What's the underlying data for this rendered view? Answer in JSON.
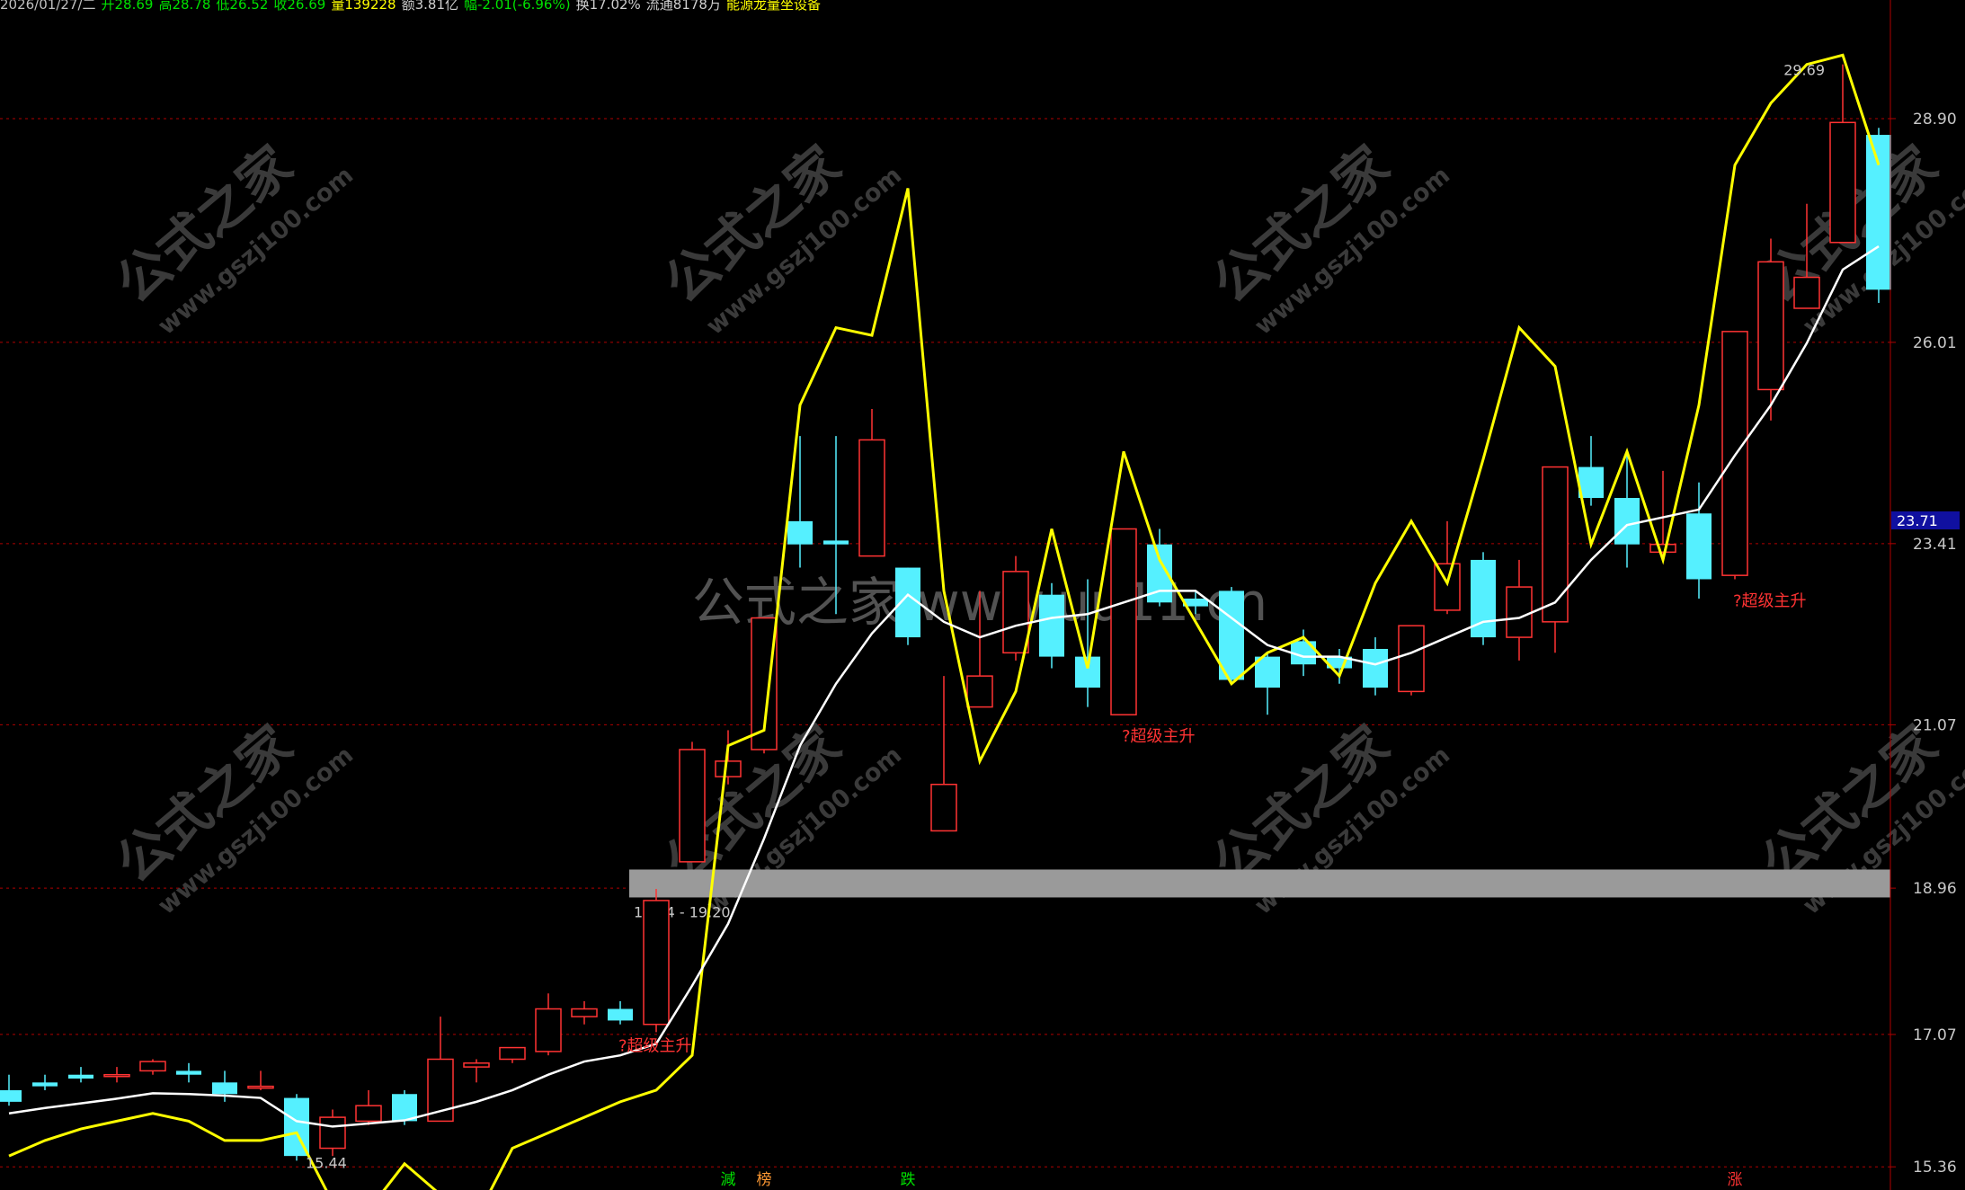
{
  "header": {
    "date": "2026/01/27/二",
    "open": "开28.69",
    "high": "高28.78",
    "low": "低26.52",
    "close": "收26.69",
    "volume": "量139228",
    "amount": "额3.81亿",
    "change": "幅-2.01(-6.96%)",
    "turnover": "换17.02%",
    "float": "流通8178万",
    "indicator": "能源龙量坐设备"
  },
  "watermark": {
    "center": "公式之家 www.uu11.cn",
    "tile_cn": "公式之家",
    "tile_url": "www.gszj100.com"
  },
  "bottom_markers": [
    "減",
    "榜",
    "跌",
    "涨"
  ],
  "colors": {
    "background": "#000000",
    "up": "#ff3333",
    "down": "#55f0ff",
    "ma": "#ffffff",
    "signal_line": "#ffff00",
    "grid": "#b00000",
    "axis_text": "#c8c8c8",
    "band": "#9a9a9a",
    "current_tag": "#1010a0"
  },
  "chart_data": {
    "type": "candlestick",
    "y_ticks": [
      15.36,
      17.07,
      18.96,
      21.07,
      23.41,
      26.01,
      28.9
    ],
    "ylim": [
      15.2,
      30.2
    ],
    "current_price": "23.71",
    "max_label": "29.69",
    "min_label": "15.44",
    "band_label": "18.84 - 19.20",
    "band_range": [
      18.84,
      19.2
    ],
    "signal_text": "?超级主升",
    "signal_indices": [
      17,
      31,
      48
    ],
    "bottom_marker_indices": [
      20,
      21,
      25,
      48
    ],
    "candles": [
      [
        16.35,
        16.55,
        16.2,
        16.15
      ],
      [
        16.45,
        16.55,
        16.4,
        16.35
      ],
      [
        16.55,
        16.65,
        16.5,
        16.45
      ],
      [
        16.55,
        16.65,
        16.55,
        16.45
      ],
      [
        16.6,
        16.75,
        16.72,
        16.55
      ],
      [
        16.6,
        16.7,
        16.55,
        16.45
      ],
      [
        16.45,
        16.6,
        16.3,
        16.2
      ],
      [
        16.4,
        16.6,
        16.4,
        16.35
      ],
      [
        16.25,
        16.3,
        15.5,
        15.44
      ],
      [
        15.6,
        16.1,
        16.0,
        15.5
      ],
      [
        15.95,
        16.35,
        16.15,
        15.9
      ],
      [
        16.3,
        16.35,
        15.95,
        15.9
      ],
      [
        15.95,
        17.3,
        16.75,
        15.95
      ],
      [
        16.65,
        16.75,
        16.7,
        16.45
      ],
      [
        16.75,
        16.85,
        16.9,
        16.7
      ],
      [
        16.85,
        17.6,
        17.4,
        16.8
      ],
      [
        17.3,
        17.5,
        17.4,
        17.2
      ],
      [
        17.4,
        17.5,
        17.25,
        17.2
      ],
      [
        17.2,
        18.95,
        18.8,
        17.1
      ],
      [
        19.3,
        20.85,
        20.75,
        19.3
      ],
      [
        20.4,
        21.0,
        20.6,
        20.3
      ],
      [
        20.75,
        22.4,
        22.45,
        20.7
      ],
      [
        23.7,
        24.8,
        23.4,
        23.1
      ],
      [
        23.45,
        24.8,
        23.4,
        22.5
      ],
      [
        23.25,
        25.15,
        24.75,
        23.25
      ],
      [
        23.1,
        23.1,
        22.2,
        22.1
      ],
      [
        19.7,
        21.7,
        20.3,
        19.8
      ],
      [
        21.3,
        22.8,
        21.7,
        21.3
      ],
      [
        22.0,
        23.25,
        23.05,
        21.9
      ],
      [
        22.75,
        22.9,
        21.95,
        21.8
      ],
      [
        21.95,
        22.95,
        21.55,
        21.3
      ],
      [
        21.2,
        23.6,
        23.6,
        21.2
      ],
      [
        23.4,
        23.6,
        22.65,
        22.6
      ],
      [
        22.7,
        22.8,
        22.6,
        22.5
      ],
      [
        22.8,
        22.85,
        21.65,
        21.6
      ],
      [
        21.95,
        22.0,
        21.55,
        21.2
      ],
      [
        22.15,
        22.3,
        21.85,
        21.7
      ],
      [
        21.95,
        22.05,
        21.8,
        21.6
      ],
      [
        22.05,
        22.2,
        21.55,
        21.45
      ],
      [
        21.5,
        22.2,
        22.35,
        21.45
      ],
      [
        22.55,
        23.7,
        23.15,
        22.5
      ],
      [
        23.2,
        23.3,
        22.2,
        22.1
      ],
      [
        22.2,
        23.2,
        22.85,
        21.9
      ],
      [
        22.4,
        24.4,
        24.4,
        22.0
      ],
      [
        24.4,
        24.8,
        24.0,
        23.9
      ],
      [
        24.0,
        24.6,
        23.4,
        23.1
      ],
      [
        23.3,
        24.35,
        23.4,
        23.2
      ],
      [
        23.8,
        24.2,
        22.95,
        22.7
      ],
      [
        23.0,
        26.1,
        26.15,
        22.95
      ],
      [
        25.4,
        27.35,
        27.05,
        25.0
      ],
      [
        26.45,
        27.8,
        26.85,
        26.5
      ],
      [
        27.3,
        29.6,
        28.85,
        27.4
      ],
      [
        28.69,
        28.78,
        26.69,
        26.52
      ]
    ],
    "ma": [
      16.05,
      16.12,
      16.18,
      16.24,
      16.31,
      16.3,
      16.28,
      16.25,
      15.95,
      15.88,
      15.92,
      15.96,
      16.08,
      16.2,
      16.35,
      16.55,
      16.72,
      16.8,
      16.95,
      17.7,
      18.5,
      19.6,
      20.8,
      21.6,
      22.25,
      22.75,
      22.4,
      22.2,
      22.35,
      22.45,
      22.5,
      22.65,
      22.8,
      22.8,
      22.45,
      22.1,
      21.95,
      21.95,
      21.85,
      22.0,
      22.2,
      22.4,
      22.45,
      22.65,
      23.2,
      23.65,
      23.75,
      23.85,
      24.55,
      25.2,
      26.0,
      26.95,
      27.25
    ],
    "signal_line": [
      15.5,
      15.7,
      15.85,
      15.95,
      16.05,
      15.95,
      15.7,
      15.7,
      15.8,
      14.9,
      14.8,
      15.4,
      15.0,
      14.7,
      15.6,
      15.8,
      16.0,
      16.2,
      16.35,
      16.8,
      20.8,
      21.0,
      25.2,
      26.2,
      26.1,
      28.0,
      22.8,
      20.6,
      21.5,
      23.6,
      21.8,
      24.6,
      23.2,
      22.4,
      21.6,
      22.0,
      22.2,
      21.7,
      22.9,
      23.7,
      22.9,
      24.5,
      26.2,
      25.7,
      23.4,
      24.6,
      23.2,
      25.2,
      28.3,
      29.1,
      29.6,
      29.72,
      28.3
    ]
  }
}
